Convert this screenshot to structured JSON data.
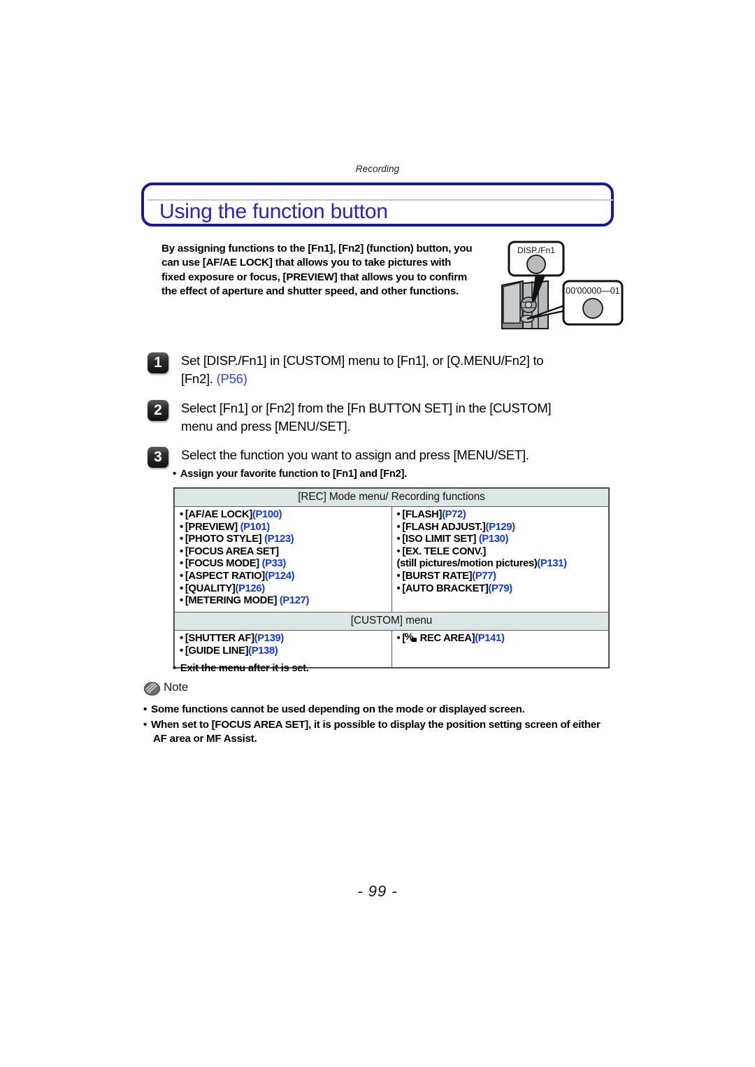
{
  "header": {
    "running_head": "Recording"
  },
  "title": {
    "text": "Using the function button"
  },
  "intro": {
    "lines": [
      "By assigning functions to the [Fn1], [Fn2] (function) button, you",
      "can use [AF/AE LOCK] that allows you to take pictures with",
      "fixed exposure or focus, [PREVIEW] that allows you to confirm",
      "the effect of aperture and shutter speed, and other functions."
    ]
  },
  "illustration": {
    "callout_top_label": "DISP./Fn1",
    "callout_bottom_label": "00'00000—01"
  },
  "steps": [
    {
      "number": "1",
      "lines": [
        "Set [DISP./Fn1] in [CUSTOM] menu to [Fn1], or [Q.MENU/Fn2] to",
        "[Fn2]."
      ],
      "ref": "(P56)"
    },
    {
      "number": "2",
      "lines": [
        "Select [Fn1] or [Fn2] from the [Fn BUTTON SET] in the [CUSTOM]",
        "menu and press [MENU/SET]."
      ],
      "ref": ""
    },
    {
      "number": "3",
      "lines": [
        "Select the function you want to assign and press [MENU/SET]."
      ],
      "ref": ""
    }
  ],
  "sub_bullet": "Assign your favorite function to [Fn1] and [Fn2].",
  "table": {
    "section1_header": "[REC] Mode menu/ Recording functions",
    "section1_left": [
      {
        "label": "[AF/AE LOCK]",
        "ref": "(P100)"
      },
      {
        "label": "[PREVIEW] ",
        "ref": "(P101)"
      },
      {
        "label": "[PHOTO STYLE] ",
        "ref": "(P123)"
      },
      {
        "label": "[FOCUS AREA SET]",
        "ref": ""
      },
      {
        "label": "[FOCUS MODE] ",
        "ref": "(P33)"
      },
      {
        "label": "[ASPECT RATIO]",
        "ref": "(P124)"
      },
      {
        "label": "[QUALITY]",
        "ref": "(P126)"
      },
      {
        "label": "[METERING MODE] ",
        "ref": "(P127)"
      }
    ],
    "section1_right": [
      {
        "label": "[FLASH]",
        "ref": "(P72)"
      },
      {
        "label": "[FLASH ADJUST.]",
        "ref": "(P129)"
      },
      {
        "label": "[ISO LIMIT SET] ",
        "ref": "(P130)"
      },
      {
        "label": "[EX. TELE CONV.]",
        "ref": ""
      },
      {
        "label": "(still pictures/motion pictures)",
        "ref": "(P131)",
        "sub": true
      },
      {
        "label": "[BURST RATE]",
        "ref": "(P77)"
      },
      {
        "label": "[AUTO BRACKET]",
        "ref": "(P79)"
      }
    ],
    "section2_header": "[CUSTOM] menu",
    "section2_left": [
      {
        "label": "[SHUTTER AF]",
        "ref": "(P139)"
      },
      {
        "label": "[GUIDE LINE]",
        "ref": "(P138)"
      }
    ],
    "section2_right": [
      {
        "label": " REC AREA]",
        "ref": "(P141)",
        "icon": "motion-picture-icon",
        "prefix": "["
      }
    ]
  },
  "exit_bullet": "Exit the menu after it is set.",
  "note": {
    "label": "Note",
    "items": [
      {
        "lines": [
          "Some functions cannot be used depending on the mode or displayed screen."
        ]
      },
      {
        "lines": [
          "When set to [FOCUS AREA SET], it is possible to display the position setting screen of either",
          "AF area or MF Assist."
        ]
      }
    ]
  },
  "footer": {
    "page_number": "- 99 -"
  },
  "colors": {
    "title_blue": "#2a21c4",
    "border_blue": "#1b189e",
    "ref_blue": "#1038dc",
    "table_header_bg": "#dde6e6"
  }
}
